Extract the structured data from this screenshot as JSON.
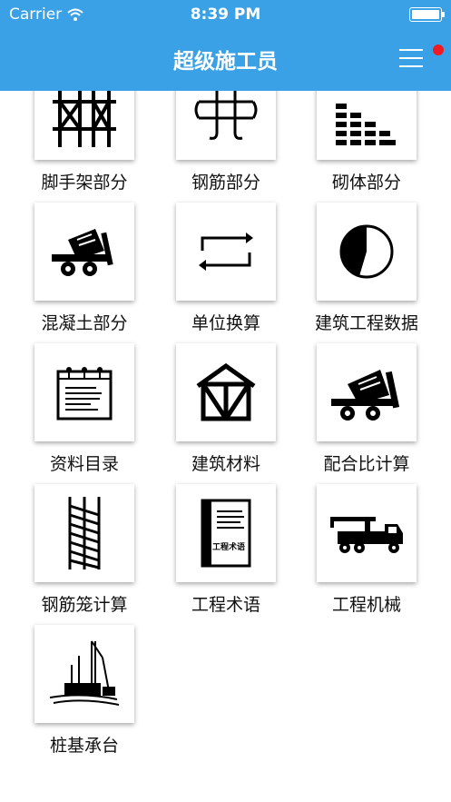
{
  "status_bar": {
    "carrier": "Carrier",
    "time": "8:39 PM"
  },
  "header": {
    "title": "超级施工员",
    "accent_color": "#3aa1e6",
    "badge_color": "#ee1b24"
  },
  "grid": {
    "items": [
      {
        "label": "脚手架部分",
        "icon": "scaffold-icon"
      },
      {
        "label": "钢筋部分",
        "icon": "rebar-icon"
      },
      {
        "label": "砌体部分",
        "icon": "brick-wall-icon"
      },
      {
        "label": "混凝土部分",
        "icon": "concrete-mixer-icon"
      },
      {
        "label": "单位换算",
        "icon": "convert-arrows-icon"
      },
      {
        "label": "建筑工程数据",
        "icon": "pie-chart-icon"
      },
      {
        "label": "资料目录",
        "icon": "calendar-list-icon"
      },
      {
        "label": "建筑材料",
        "icon": "house-frame-icon"
      },
      {
        "label": "配合比计算",
        "icon": "concrete-mixer-icon"
      },
      {
        "label": "钢筋笼计算",
        "icon": "rebar-cage-icon"
      },
      {
        "label": "工程术语",
        "icon": "book-icon",
        "icon_text": "工程术语"
      },
      {
        "label": "工程机械",
        "icon": "crane-truck-icon"
      },
      {
        "label": "桩基承台",
        "icon": "pile-driver-icon"
      }
    ]
  }
}
